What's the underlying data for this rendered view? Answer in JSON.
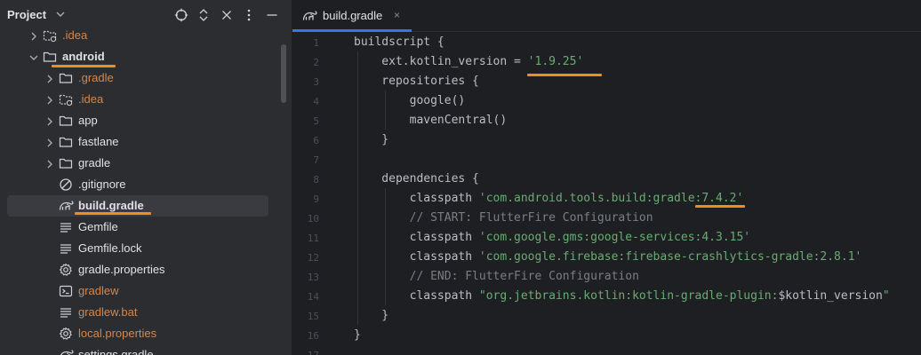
{
  "project_panel": {
    "title": "Project",
    "header_icons": [
      "locate-icon",
      "expand-collapse-icon",
      "close-icon",
      "more-options-icon"
    ],
    "tree": [
      {
        "label": ".idea",
        "icon": "idea-folder-icon",
        "arrow": "collapsed",
        "ignored": true
      },
      {
        "label": "android",
        "icon": "folder-icon",
        "arrow": "expanded",
        "ignored": false
      },
      {
        "label": ".gradle",
        "icon": "folder-icon",
        "arrow": "collapsed",
        "ignored": true
      },
      {
        "label": ".idea",
        "icon": "idea-folder-icon",
        "arrow": "collapsed",
        "ignored": true
      },
      {
        "label": "app",
        "icon": "folder-icon",
        "arrow": "collapsed",
        "ignored": false
      },
      {
        "label": "fastlane",
        "icon": "folder-icon",
        "arrow": "collapsed",
        "ignored": false
      },
      {
        "label": "gradle",
        "icon": "folder-icon",
        "arrow": "collapsed",
        "ignored": false
      },
      {
        "label": ".gitignore",
        "icon": "ignore-file-icon",
        "arrow": "none",
        "ignored": false
      },
      {
        "label": "build.gradle",
        "icon": "gradle-icon",
        "arrow": "none",
        "ignored": false,
        "selected": true
      },
      {
        "label": "Gemfile",
        "icon": "text-file-icon",
        "arrow": "none",
        "ignored": false
      },
      {
        "label": "Gemfile.lock",
        "icon": "text-file-icon",
        "arrow": "none",
        "ignored": false
      },
      {
        "label": "gradle.properties",
        "icon": "settings-file-icon",
        "arrow": "none",
        "ignored": false
      },
      {
        "label": "gradlew",
        "icon": "shell-script-icon",
        "arrow": "none",
        "ignored": true
      },
      {
        "label": "gradlew.bat",
        "icon": "text-file-icon",
        "arrow": "none",
        "ignored": true
      },
      {
        "label": "local.properties",
        "icon": "settings-file-icon",
        "arrow": "none",
        "ignored": true
      },
      {
        "label": "settings.gradle",
        "icon": "gradle-icon",
        "arrow": "none",
        "ignored": false
      }
    ]
  },
  "editor": {
    "tab": {
      "label": "build.gradle",
      "icon": "gradle-icon",
      "close": "×"
    },
    "lines": [
      {
        "n": "1",
        "parts": [
          {
            "t": "buildscript {",
            "c": ""
          }
        ]
      },
      {
        "n": "2",
        "parts": [
          {
            "t": "    ext.kotlin_version = ",
            "c": ""
          },
          {
            "t": "'1.9.25'",
            "c": "str"
          }
        ]
      },
      {
        "n": "3",
        "parts": [
          {
            "t": "    repositories {",
            "c": ""
          }
        ]
      },
      {
        "n": "4",
        "parts": [
          {
            "t": "        google()",
            "c": ""
          }
        ]
      },
      {
        "n": "5",
        "parts": [
          {
            "t": "        mavenCentral()",
            "c": ""
          }
        ]
      },
      {
        "n": "6",
        "parts": [
          {
            "t": "    }",
            "c": ""
          }
        ]
      },
      {
        "n": "7",
        "parts": []
      },
      {
        "n": "8",
        "parts": [
          {
            "t": "    dependencies {",
            "c": ""
          }
        ]
      },
      {
        "n": "9",
        "parts": [
          {
            "t": "        classpath ",
            "c": ""
          },
          {
            "t": "'com.android.tools.build:gradle:7.4.2'",
            "c": "str"
          }
        ]
      },
      {
        "n": "10",
        "parts": [
          {
            "t": "        // START: FlutterFire Configuration",
            "c": "cmt"
          }
        ]
      },
      {
        "n": "11",
        "parts": [
          {
            "t": "        classpath ",
            "c": ""
          },
          {
            "t": "'com.google.gms:google-services:4.3.15'",
            "c": "str"
          }
        ]
      },
      {
        "n": "12",
        "parts": [
          {
            "t": "        classpath ",
            "c": ""
          },
          {
            "t": "'com.google.firebase:firebase-crashlytics-gradle:2.8.1'",
            "c": "str"
          }
        ]
      },
      {
        "n": "13",
        "parts": [
          {
            "t": "        // END: FlutterFire Configuration",
            "c": "cmt"
          }
        ]
      },
      {
        "n": "14",
        "parts": [
          {
            "t": "        classpath ",
            "c": ""
          },
          {
            "t": "\"org.jetbrains.kotlin:kotlin-gradle-plugin:",
            "c": "str"
          },
          {
            "t": "$kotlin_version",
            "c": ""
          },
          {
            "t": "\"",
            "c": "str"
          }
        ]
      },
      {
        "n": "15",
        "parts": [
          {
            "t": "    }",
            "c": ""
          }
        ]
      },
      {
        "n": "16",
        "parts": [
          {
            "t": "}",
            "c": ""
          }
        ]
      },
      {
        "n": "17",
        "parts": []
      }
    ]
  },
  "colors": {
    "panel_bg": "#2b2d30",
    "editor_bg": "#1e1f22",
    "selection": "#393b40",
    "ignored_file": "#d5864b",
    "string": "#6aab73",
    "comment": "#7a7e85",
    "highlight_underline": "#f28b20",
    "active_tab_line": "#3574f0"
  }
}
